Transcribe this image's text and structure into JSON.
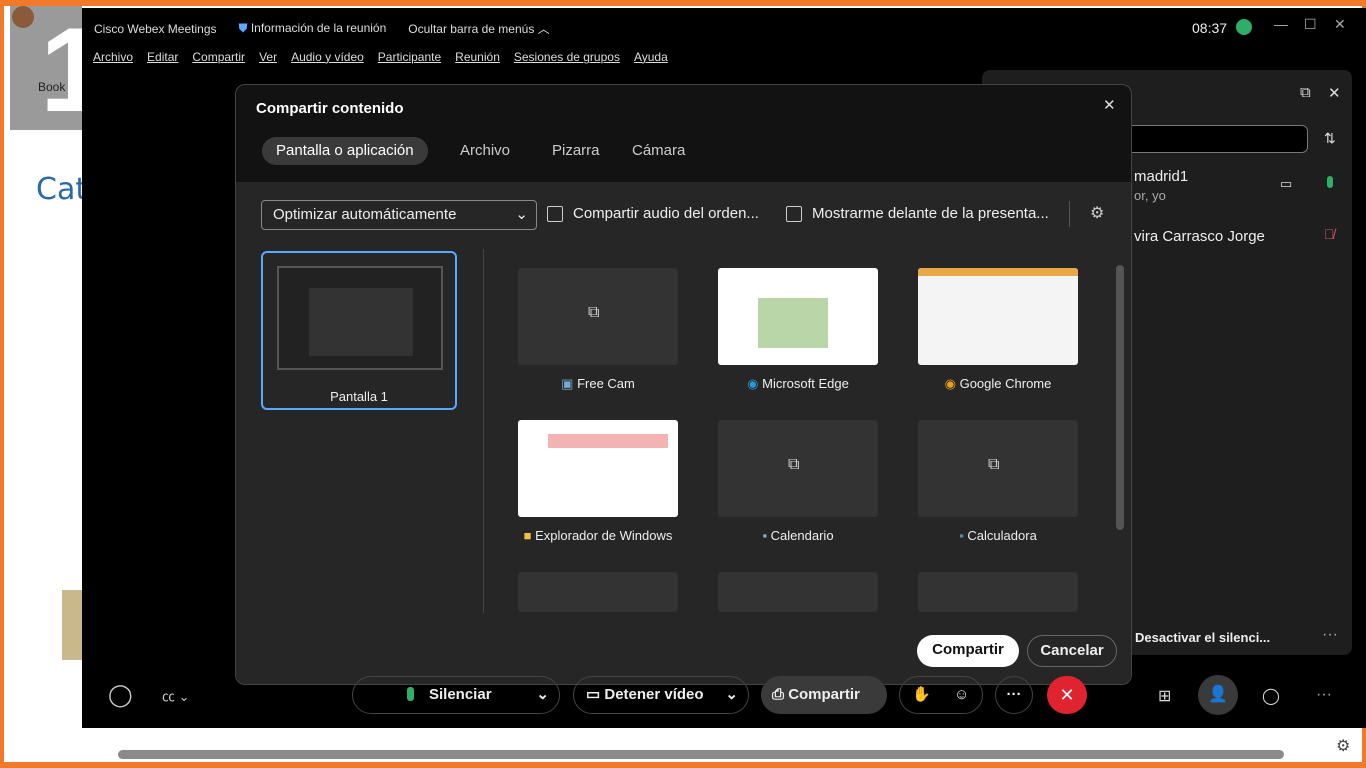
{
  "background_app": {
    "big_number": "1",
    "fragment_text": "Cat",
    "book_label": "Book"
  },
  "titlebar": {
    "app_name": "Cisco Webex Meetings",
    "meeting_info": "Información de la reunión",
    "hide_menu": "Ocultar barra de menús",
    "time": "08:37"
  },
  "menu": [
    "Archivo",
    "Editar",
    "Compartir",
    "Ver",
    "Audio y vídeo",
    "Participante",
    "Reunión",
    "Sesiones de grupos",
    "Ayuda"
  ],
  "participants": {
    "items": [
      {
        "name": "madrid1",
        "role": "or, yo",
        "mic_color": "#2eae6a"
      },
      {
        "name": "vira Carrasco Jorge",
        "mic_color": "#e0506a"
      }
    ],
    "footer": "Desactivar el silenci..."
  },
  "dialog": {
    "title": "Compartir contenido",
    "tabs": [
      "Pantalla o aplicación",
      "Archivo",
      "Pizarra",
      "Cámara"
    ],
    "optimize_select": "Optimizar automáticamente",
    "share_audio": "Compartir audio del orden...",
    "show_me": "Mostrarme delante de la presenta...",
    "screen_label": "Pantalla 1",
    "apps": [
      {
        "name": "Free Cam",
        "icon": "freecam-icon"
      },
      {
        "name": "Microsoft Edge",
        "icon": "edge-icon"
      },
      {
        "name": "Google Chrome",
        "icon": "chrome-icon"
      },
      {
        "name": "Explorador de Windows",
        "icon": "folder-icon"
      },
      {
        "name": "Calendario",
        "icon": "calendar-icon"
      },
      {
        "name": "Calculadora",
        "icon": "calculator-icon"
      }
    ],
    "share_button": "Compartir",
    "cancel_button": "Cancelar"
  },
  "controls": {
    "mute": "Silenciar",
    "stop_video": "Detener vídeo",
    "share": "Compartir"
  },
  "colors": {
    "accent": "#5aa8ff",
    "end_call": "#e0242f",
    "border": "#f07a2a"
  }
}
